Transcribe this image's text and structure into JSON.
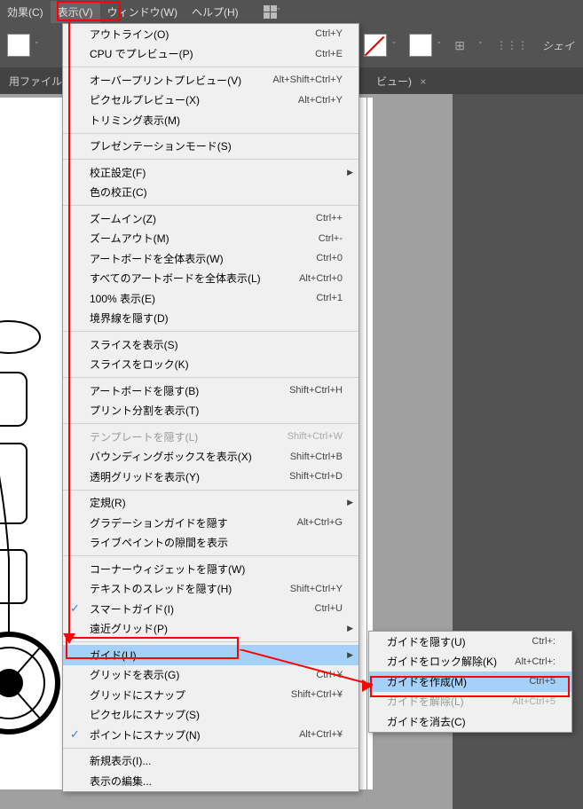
{
  "menubar": {
    "effect": "効果(C)",
    "view": "表示(V)",
    "window": "ウィンドウ(W)",
    "help": "ヘルプ(H)"
  },
  "tabbar": {
    "file_label": "用ファイル",
    "preview": "ビュー)"
  },
  "toolbar": {
    "shape_label": "シェイ"
  },
  "menu": {
    "outline": "アウトライン(O)",
    "outline_sc": "Ctrl+Y",
    "cpu_preview": "CPU でプレビュー(P)",
    "cpu_preview_sc": "Ctrl+E",
    "overprint": "オーバープリントプレビュー(V)",
    "overprint_sc": "Alt+Shift+Ctrl+Y",
    "pixel_preview": "ピクセルプレビュー(X)",
    "pixel_preview_sc": "Alt+Ctrl+Y",
    "trim_view": "トリミング表示(M)",
    "presentation": "プレゼンテーションモード(S)",
    "proof_setup": "校正設定(F)",
    "proof_colors": "色の校正(C)",
    "zoom_in": "ズームイン(Z)",
    "zoom_in_sc": "Ctrl++",
    "zoom_out": "ズームアウト(M)",
    "zoom_out_sc": "Ctrl+-",
    "fit_artboard": "アートボードを全体表示(W)",
    "fit_artboard_sc": "Ctrl+0",
    "fit_all": "すべてのアートボードを全体表示(L)",
    "fit_all_sc": "Alt+Ctrl+0",
    "actual_size": "100% 表示(E)",
    "actual_size_sc": "Ctrl+1",
    "hide_edges": "境界線を隠す(D)",
    "show_slices": "スライスを表示(S)",
    "lock_slices": "スライスをロック(K)",
    "hide_artboards": "アートボードを隠す(B)",
    "hide_artboards_sc": "Shift+Ctrl+H",
    "show_print_tiling": "プリント分割を表示(T)",
    "hide_template": "テンプレートを隠す(L)",
    "hide_template_sc": "Shift+Ctrl+W",
    "show_bbox": "バウンディングボックスを表示(X)",
    "show_bbox_sc": "Shift+Ctrl+B",
    "show_transparency_grid": "透明グリッドを表示(Y)",
    "show_transparency_grid_sc": "Shift+Ctrl+D",
    "rulers": "定規(R)",
    "hide_gradient": "グラデーションガイドを隠す",
    "hide_gradient_sc": "Alt+Ctrl+G",
    "show_livepaint": "ライブペイントの隙間を表示",
    "hide_corner_widget": "コーナーウィジェットを隠す(W)",
    "hide_text_threads": "テキストのスレッドを隠す(H)",
    "hide_text_threads_sc": "Shift+Ctrl+Y",
    "smart_guides": "スマートガイド(I)",
    "smart_guides_sc": "Ctrl+U",
    "perspective_grid": "遠近グリッド(P)",
    "guides": "ガイド(U)",
    "show_grid": "グリッドを表示(G)",
    "show_grid_sc": "Ctrl+¥",
    "snap_to_grid": "グリッドにスナップ",
    "snap_to_grid_sc": "Shift+Ctrl+¥",
    "snap_to_pixel": "ピクセルにスナップ(S)",
    "snap_to_point": "ポイントにスナップ(N)",
    "snap_to_point_sc": "Alt+Ctrl+¥",
    "new_view": "新規表示(I)...",
    "edit_views": "表示の編集..."
  },
  "submenu": {
    "hide_guides": "ガイドを隠す(U)",
    "hide_guides_sc": "Ctrl+:",
    "unlock_guides": "ガイドをロック解除(K)",
    "unlock_guides_sc": "Alt+Ctrl+:",
    "make_guides": "ガイドを作成(M)",
    "make_guides_sc": "Ctrl+5",
    "release_guides": "ガイドを解除(L)",
    "release_guides_sc": "Alt+Ctrl+5",
    "clear_guides": "ガイドを消去(C)"
  }
}
